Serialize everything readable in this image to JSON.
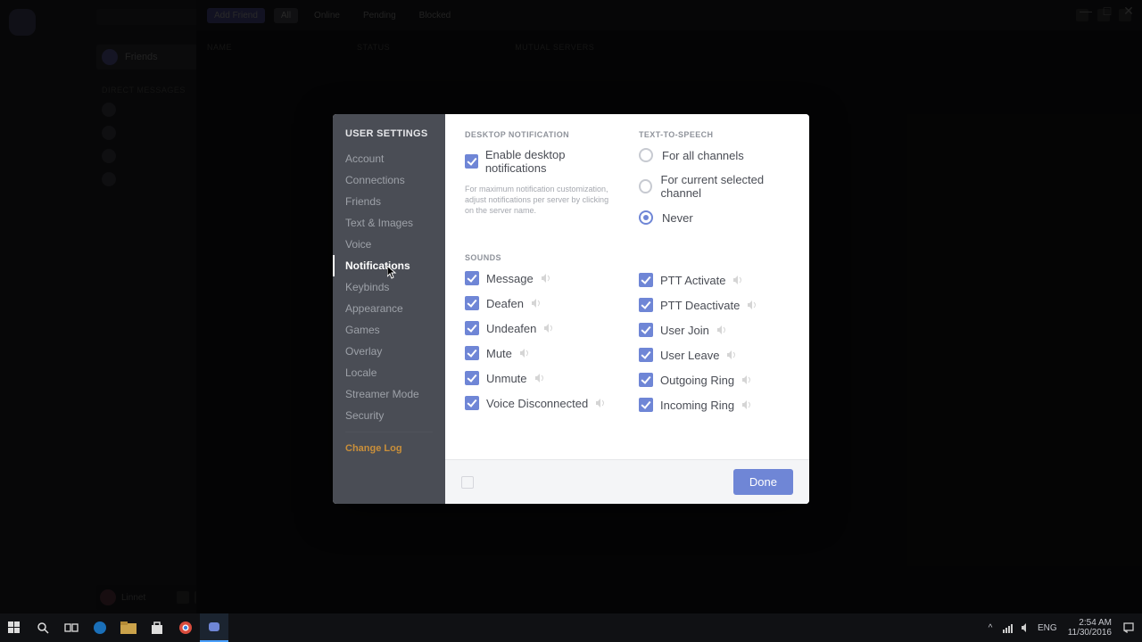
{
  "window": {
    "minimize": "—",
    "maximize": "□",
    "close": "✕"
  },
  "bg": {
    "friends_label": "Friends",
    "dm_header": "DIRECT MESSAGES",
    "topbar": {
      "add_friend": "Add Friend",
      "tabs": [
        "All",
        "Online",
        "Pending",
        "Blocked"
      ]
    },
    "thead": [
      "NAME",
      "STATUS",
      "MUTUAL SERVERS"
    ],
    "user": {
      "name": "Linnet"
    }
  },
  "modal": {
    "title": "USER SETTINGS",
    "nav": [
      {
        "label": "Account"
      },
      {
        "label": "Connections"
      },
      {
        "label": "Friends"
      },
      {
        "label": "Text & Images"
      },
      {
        "label": "Voice"
      },
      {
        "label": "Notifications",
        "active": true
      },
      {
        "label": "Keybinds"
      },
      {
        "label": "Appearance"
      },
      {
        "label": "Games"
      },
      {
        "label": "Overlay"
      },
      {
        "label": "Locale"
      },
      {
        "label": "Streamer Mode"
      },
      {
        "label": "Security"
      }
    ],
    "changelog": "Change Log",
    "desktop": {
      "header": "DESKTOP NOTIFICATION",
      "enable_label": "Enable desktop notifications",
      "helper": "For maximum notification customization, adjust notifications per server by clicking on the server name."
    },
    "tts": {
      "header": "TEXT-TO-SPEECH",
      "options": [
        "For all channels",
        "For current selected channel",
        "Never"
      ],
      "selected": 2
    },
    "sounds": {
      "header": "SOUNDS",
      "left": [
        "Message",
        "Deafen",
        "Undeafen",
        "Mute",
        "Unmute",
        "Voice Disconnected"
      ],
      "right": [
        "PTT Activate",
        "PTT Deactivate",
        "User Join",
        "User Leave",
        "Outgoing Ring",
        "Incoming Ring"
      ]
    },
    "done": "Done"
  },
  "taskbar": {
    "lang": "ENG",
    "time": "2:54 AM",
    "date": "11/30/2016"
  }
}
